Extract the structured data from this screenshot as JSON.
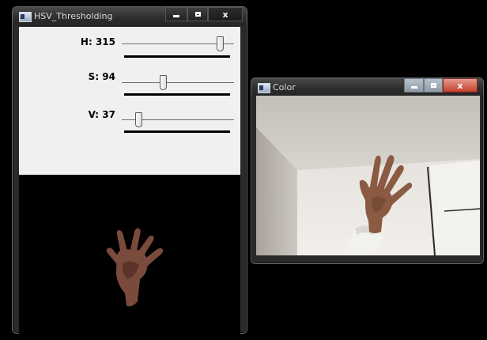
{
  "windows": {
    "thresholding": {
      "title": "HSV_Thresholding",
      "trackbars": [
        {
          "label": "H: 315",
          "value": 315,
          "max": 360
        },
        {
          "label": "S: 94",
          "value": 94,
          "max": 255
        },
        {
          "label": "V: 37",
          "value": 37,
          "max": 255
        }
      ],
      "buttons": {
        "close": "x"
      }
    },
    "color": {
      "title": "Color",
      "buttons": {
        "close": "x"
      }
    }
  },
  "icons": [
    "window-icon",
    "minimize-icon",
    "maximize-icon",
    "close-icon"
  ],
  "colors": {
    "desktop": "#000000",
    "trackbar_panel": "#f0f0f0",
    "close_active": "#c5402c"
  }
}
